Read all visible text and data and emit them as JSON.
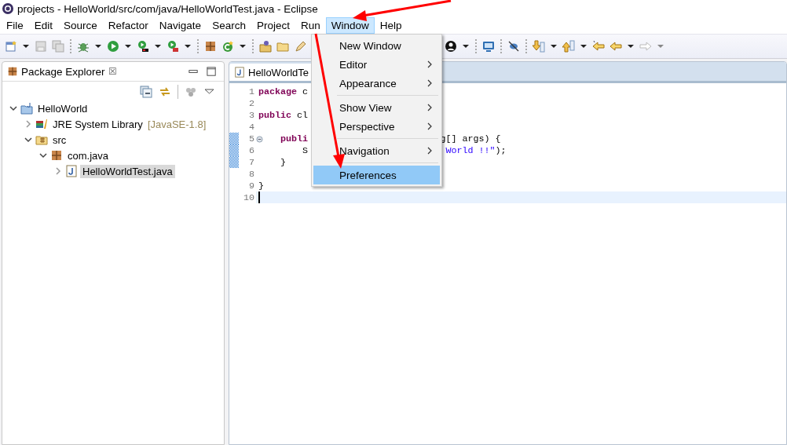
{
  "window": {
    "title": "projects - HelloWorld/src/com/java/HelloWorldTest.java - Eclipse"
  },
  "menu_bar": [
    {
      "label": "File",
      "selected": false
    },
    {
      "label": "Edit",
      "selected": false
    },
    {
      "label": "Source",
      "selected": false
    },
    {
      "label": "Refactor",
      "selected": false
    },
    {
      "label": "Navigate",
      "selected": false
    },
    {
      "label": "Search",
      "selected": false
    },
    {
      "label": "Project",
      "selected": false
    },
    {
      "label": "Run",
      "selected": false
    },
    {
      "label": "Window",
      "selected": true
    },
    {
      "label": "Help",
      "selected": false
    }
  ],
  "window_menu": [
    {
      "label": "New Window",
      "has_submenu": false,
      "selected": false
    },
    {
      "label": "Editor",
      "has_submenu": true,
      "selected": false
    },
    {
      "label": "Appearance",
      "has_submenu": true,
      "selected": false
    },
    {
      "kind": "separator"
    },
    {
      "label": "Show View",
      "has_submenu": true,
      "selected": false
    },
    {
      "label": "Perspective",
      "has_submenu": true,
      "selected": false
    },
    {
      "kind": "separator"
    },
    {
      "label": "Navigation",
      "has_submenu": true,
      "selected": false
    },
    {
      "kind": "separator"
    },
    {
      "label": "Preferences",
      "has_submenu": false,
      "selected": true
    }
  ],
  "package_explorer": {
    "title": "Package Explorer",
    "close": "☒",
    "tree": [
      {
        "label": "HelloWorld",
        "kind": "project",
        "expanded": true,
        "selected": false,
        "children": [
          {
            "label": "JRE System Library",
            "decoration": "[JavaSE-1.8]",
            "kind": "library",
            "expanded": false,
            "selected": false
          },
          {
            "label": "src",
            "kind": "folder",
            "expanded": true,
            "selected": false,
            "children": [
              {
                "label": "com.java",
                "kind": "package",
                "expanded": true,
                "selected": false,
                "children": [
                  {
                    "label": "HelloWorldTest.java",
                    "kind": "file",
                    "expanded": false,
                    "selected": true
                  }
                ]
              }
            ]
          }
        ]
      }
    ]
  },
  "editor": {
    "tab": "HelloWorldTe",
    "lines": [
      {
        "number": "1",
        "left": [
          {
            "kind": "keyword",
            "text": "package"
          },
          {
            "kind": "plain",
            "text": " c"
          }
        ]
      },
      {
        "number": "2"
      },
      {
        "number": "3",
        "left": [
          {
            "kind": "keyword",
            "text": "public"
          },
          {
            "kind": "plain",
            "text": " cl"
          }
        ]
      },
      {
        "number": "4"
      },
      {
        "number": "5",
        "fold": true,
        "changed": true,
        "left": [
          {
            "kind": "keyword",
            "text": "publi"
          }
        ],
        "right": [
          {
            "kind": "plain",
            "text": "g[] args) {"
          }
        ]
      },
      {
        "number": "6",
        "changed": true,
        "left": [
          {
            "kind": "plain",
            "text": "        S"
          }
        ],
        "right": [
          {
            "kind": "string",
            "text": "World !!\""
          },
          {
            "kind": "plain",
            "text": ");"
          }
        ]
      },
      {
        "number": "7",
        "changed": true,
        "left": [
          {
            "kind": "plain",
            "text": "    }"
          }
        ]
      },
      {
        "number": "8"
      },
      {
        "number": "9",
        "left": [
          {
            "kind": "plain",
            "text": "}"
          }
        ]
      },
      {
        "number": "10",
        "current": true
      }
    ]
  }
}
